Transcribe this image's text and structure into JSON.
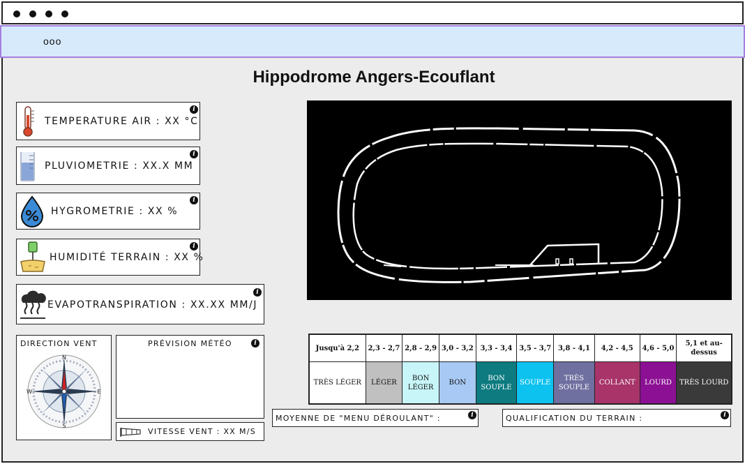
{
  "browser": {
    "url_text": "ooo"
  },
  "page": {
    "title": "Hippodrome Angers-Ecouflant"
  },
  "sensors": {
    "temperature": "TEMPERATURE AIR : XX °C",
    "rain": "PLUVIOMETRIE : XX.X MM",
    "hygro": "HYGROMETRIE : XX %",
    "soil": "HUMIDITÉ TERRAIN : XX %",
    "evapo": "EVAPOTRANSPIRATION : XX.XX MM/J"
  },
  "wind": {
    "direction_label": "DIRECTION VENT",
    "speed_label": "VITESSE VENT : XX M/S",
    "compass_letters": [
      "N",
      "E",
      "S",
      "W"
    ]
  },
  "forecast": {
    "label": "PRÉVISION MÉTÉO"
  },
  "info_glyph": "i",
  "scale": {
    "ranges": [
      "Jusqu'à 2,2",
      "2,3 - 2,7",
      "2,8 - 2,9",
      "3,0 - 3,2",
      "3,3 - 3,4",
      "3,5 - 3,7",
      "3,8 - 4,1",
      "4,2 - 4,5",
      "4,6 - 5,0",
      "5,1 et au-dessus"
    ],
    "qualities": [
      "TRÈS LÉGER",
      "LÉGER",
      "BON LÉGER",
      "BON",
      "BON SOUPLE",
      "SOUPLE",
      "TRÈS SOUPLE",
      "COLLANT",
      "LOURD",
      "TRÈS LOURD"
    ],
    "colors": [
      "#ffffff",
      "#c0c0c0",
      "#c7f5f8",
      "#a7c9f4",
      "#0d7b80",
      "#0dc2ef",
      "#6f6fa0",
      "#a8346a",
      "#8b1093",
      "#3a3a3a"
    ],
    "text_colors": [
      "#111111",
      "#111111",
      "#111111",
      "#111111",
      "#ffffff",
      "#ffffff",
      "#ffffff",
      "#ffffff",
      "#ffffff",
      "#ffffff"
    ]
  },
  "footer": {
    "average": "MOYENNE DE \"MENU DÉROULANT\" :",
    "qualification": "QUALIFICATION DU TERRAIN :"
  },
  "icons": {
    "temperature": "thermometer-icon",
    "rain": "rain-gauge-icon",
    "hygro": "humidity-drop-icon",
    "soil": "soil-probe-icon",
    "evapo": "evaporation-cloud-icon",
    "compass": "compass-rose-icon",
    "windsock": "windsock-icon",
    "info": "info-icon"
  }
}
